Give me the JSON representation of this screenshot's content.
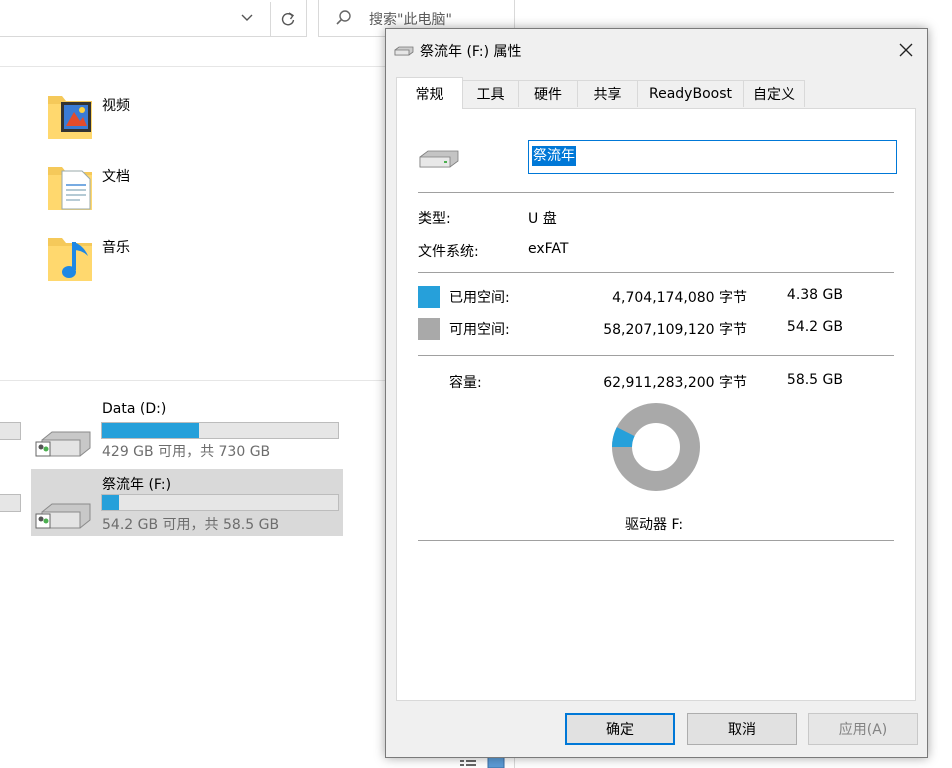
{
  "explorer": {
    "search_placeholder": "搜索\"此电脑\"",
    "folders": [
      {
        "label": "视频"
      },
      {
        "label": "文档"
      },
      {
        "label": "音乐"
      }
    ],
    "drives": [
      {
        "name": "Data (D:)",
        "subtitle": "429 GB 可用，共 730 GB",
        "used_fraction": 0.41
      },
      {
        "name": "祭流年 (F:)",
        "subtitle": "54.2 GB 可用，共 58.5 GB",
        "used_fraction": 0.07
      }
    ]
  },
  "dialog": {
    "title": "祭流年 (F:) 属性",
    "tabs": [
      "常规",
      "工具",
      "硬件",
      "共享",
      "ReadyBoost",
      "自定义"
    ],
    "active_tab": "常规",
    "volume_name": "祭流年",
    "type_label": "类型:",
    "type_value": "U 盘",
    "fs_label": "文件系统:",
    "fs_value": "exFAT",
    "used": {
      "label": "已用空间:",
      "bytes": "4,704,174,080 字节",
      "size": "4.38 GB",
      "color": "#26a0da"
    },
    "free": {
      "label": "可用空间:",
      "bytes": "58,207,109,120 字节",
      "size": "54.2 GB",
      "color": "#a9a9a9"
    },
    "capacity": {
      "label": "容量:",
      "bytes": "62,911,283,200 字节",
      "size": "58.5 GB"
    },
    "drive_caption": "驱动器 F:",
    "used_fraction": 0.0748,
    "buttons": {
      "ok": "确定",
      "cancel": "取消",
      "apply": "应用(A)"
    }
  }
}
